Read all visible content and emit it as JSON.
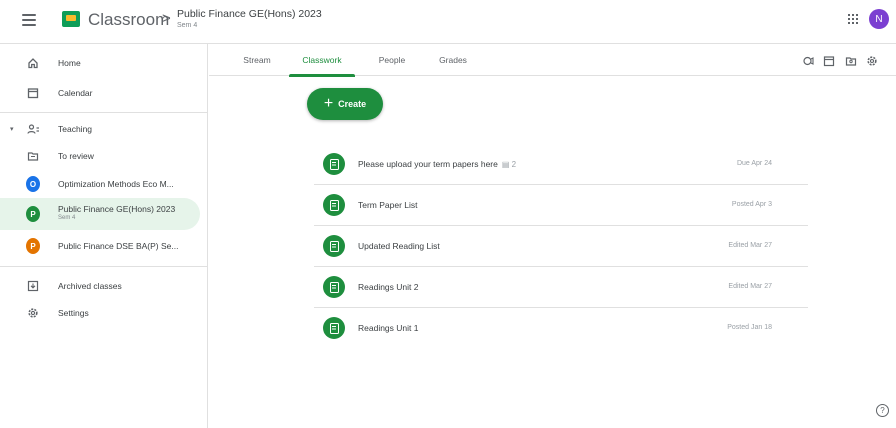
{
  "header": {
    "app_name": "Classroom",
    "separator": ">",
    "class_title": "Public Finance GE(Hons) 2023",
    "class_subtitle": "Sem 4",
    "avatar_letter": "N",
    "avatar_color": "#7b3fd1"
  },
  "sidebar": {
    "home": "Home",
    "calendar": "Calendar",
    "teaching": "Teaching",
    "to_review": "To review",
    "classes": [
      {
        "letter": "O",
        "label": "Optimization Methods Eco M...",
        "sub": "",
        "color": "#1a73e8"
      },
      {
        "letter": "P",
        "label": "Public Finance GE(Hons) 2023",
        "sub": "Sem 4",
        "color": "#1e8e3e"
      },
      {
        "letter": "P",
        "label": "Public Finance DSE BA(P) Se...",
        "sub": "",
        "color": "#e37400"
      }
    ],
    "archived": "Archived classes",
    "settings": "Settings"
  },
  "tabs": [
    "Stream",
    "Classwork",
    "People",
    "Grades"
  ],
  "active_tab": "Classwork",
  "create_label": "Create",
  "accent_color": "#1e8e3e",
  "items": [
    {
      "title": "Please upload your term papers here",
      "attach": "2",
      "date": "Due Apr 24"
    },
    {
      "title": "Term Paper List",
      "attach": "",
      "date": "Posted Apr 3"
    },
    {
      "title": "Updated Reading List",
      "attach": "",
      "date": "Edited Mar 27"
    },
    {
      "title": "Readings Unit 2",
      "attach": "",
      "date": "Edited Mar 27"
    },
    {
      "title": "Readings Unit 1",
      "attach": "",
      "date": "Posted Jan 18"
    }
  ],
  "help_label": "?"
}
